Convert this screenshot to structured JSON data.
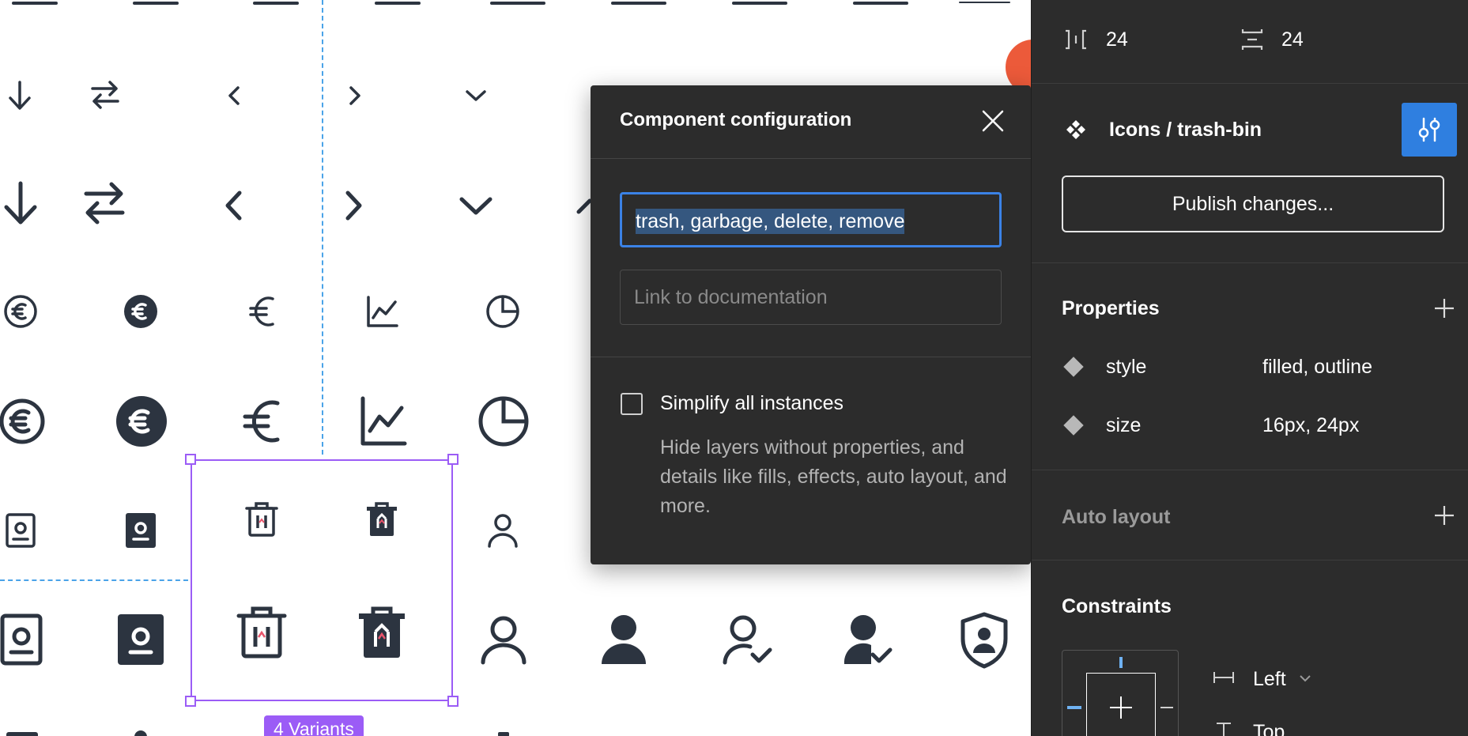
{
  "modal": {
    "title": "Component configuration",
    "keywords_value": "trash, garbage, delete, remove",
    "docs_placeholder": "Link to documentation",
    "simplify_label": "Simplify all instances",
    "simplify_desc": "Hide layers without properties, and details like fills, effects, auto layout, and more."
  },
  "canvas": {
    "variants_badge": "4 Variants"
  },
  "panel": {
    "spacing_h": "24",
    "spacing_v": "24",
    "component_name": "Icons / trash-bin",
    "publish_label": "Publish changes...",
    "properties_title": "Properties",
    "properties": [
      {
        "name": "style",
        "value": "filled, outline"
      },
      {
        "name": "size",
        "value": "16px, 24px"
      }
    ],
    "auto_layout_title": "Auto layout",
    "constraints_title": "Constraints",
    "constraint_h": "Left",
    "constraint_v": "Top"
  },
  "colors": {
    "icon": "#2c3440",
    "accent_blue": "#2f7fe0",
    "selection_purple": "#9b5cf6",
    "panel_bg": "#2c2c2c"
  }
}
